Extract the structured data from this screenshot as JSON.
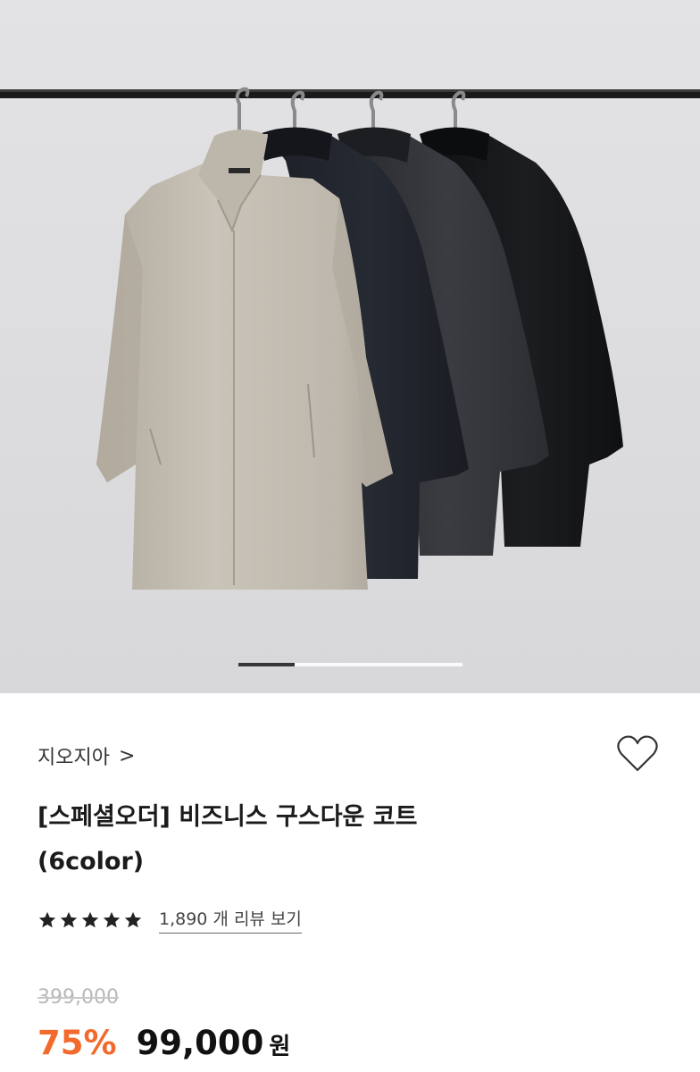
{
  "product": {
    "brand": "지오지아",
    "brand_chevron": ">",
    "title_line1": "[스페셜오더] 비즈니스 구스다운 코트",
    "title_line2": "(6color)",
    "rating_stars": 5,
    "review_link": "1,890 개 리뷰 보기",
    "original_price": "399,000",
    "discount": "75%",
    "price": "99,000",
    "currency": "원"
  },
  "gallery": {
    "current_slide_fraction": 0.25
  },
  "colors": {
    "discount": "#f26a2c",
    "star": "#222222"
  },
  "icons": {
    "wishlist": "heart-outline-icon",
    "brand_link": "chevron-right-icon",
    "rating": "star-icon"
  }
}
